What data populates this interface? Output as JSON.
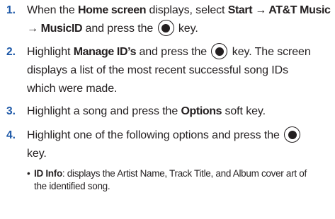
{
  "steps": [
    {
      "number": "1.",
      "parts": {
        "a": "When the ",
        "b": "Home screen",
        "c": " displays, select ",
        "d": "Start → AT&T Music",
        "e": "→ MusicID",
        "f": " and press the ",
        "g": " key."
      }
    },
    {
      "number": "2.",
      "parts": {
        "a": "Highlight ",
        "b": "Manage ID’s",
        "c": " and press the ",
        "d": " key. The screen",
        "e": "displays a list of the most recent successful song IDs",
        "f": "which were made."
      }
    },
    {
      "number": "3.",
      "parts": {
        "a": "Highlight a song and press the ",
        "b": "Options",
        "c": " soft key."
      }
    },
    {
      "number": "4.",
      "parts": {
        "a": "Highlight one of the following options and press the ",
        "b": "key."
      }
    }
  ],
  "bullets": [
    {
      "marker": "•",
      "term": "ID Info",
      "description": ": displays the Artist Name, Track Title, and Album cover art of",
      "continuation": "the identified song."
    }
  ],
  "icons": {
    "select_key": "select-key-icon"
  },
  "colors": {
    "step_number": "#1a56a6",
    "text": "#231f20"
  }
}
